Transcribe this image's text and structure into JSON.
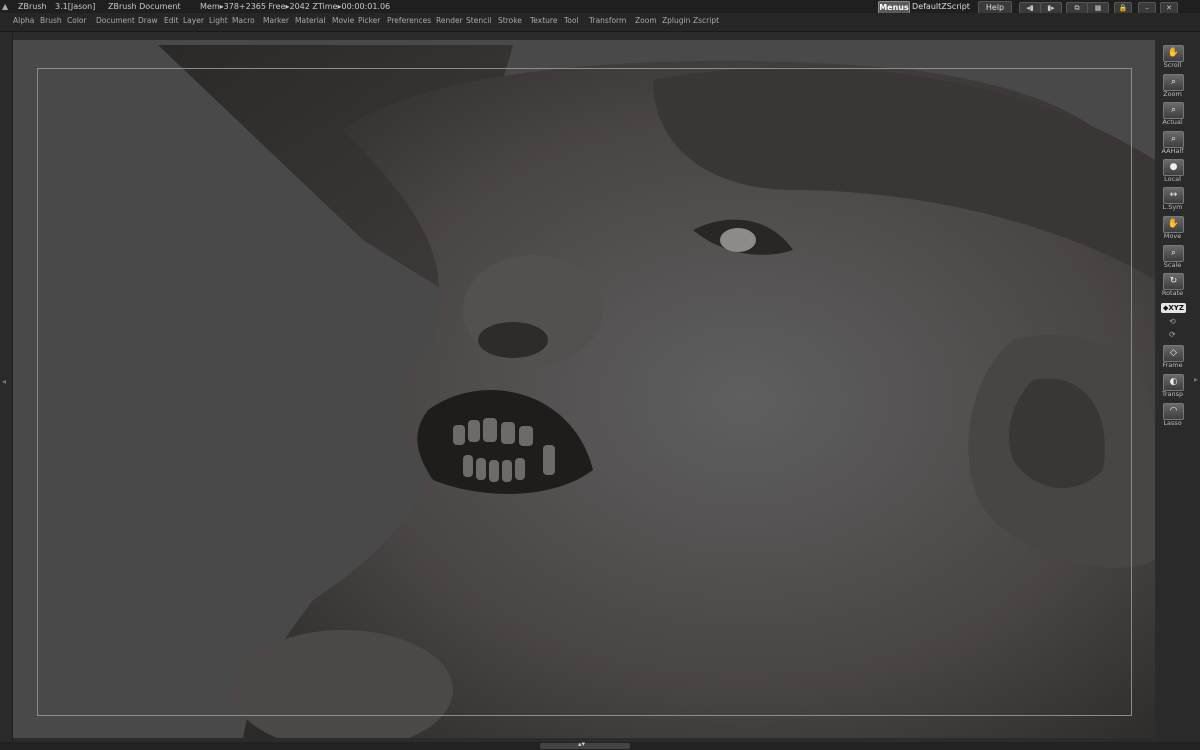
{
  "titlebar": {
    "app": "ZBrush",
    "version": "3.1[Jason]",
    "document": "ZBrush Document",
    "mem": "Mem▸378+2365 Free▸2042 ZTime▸00:00:01.06"
  },
  "topright": {
    "menus": "Menus",
    "script": "DefaultZScript",
    "help": "Help"
  },
  "menubar": [
    "Alpha",
    "Brush",
    "Color",
    "Document",
    "Draw",
    "Edit",
    "Layer",
    "Light",
    "Macro",
    "Marker",
    "Material",
    "Movie",
    "Picker",
    "Preferences",
    "Render",
    "Stencil",
    "Stroke",
    "Texture",
    "Tool",
    "Transform",
    "Zoom",
    "Zplugin",
    "Zscript"
  ],
  "right_tools": [
    {
      "label": "Scroll",
      "icon": "hand-icon"
    },
    {
      "label": "Zoom",
      "icon": "magnifier-icon"
    },
    {
      "label": "Actual",
      "icon": "magnifier-icon"
    },
    {
      "label": "AAHalf",
      "icon": "magnifier-icon"
    },
    {
      "label": "Local",
      "icon": "sphere-icon"
    },
    {
      "label": "L.Sym",
      "icon": "symmetry-icon"
    },
    {
      "label": "Move",
      "icon": "hand-icon"
    },
    {
      "label": "Scale",
      "icon": "magnifier-icon"
    },
    {
      "label": "Rotate",
      "icon": "rotate-icon"
    }
  ],
  "xyz_label": "◆XYZ",
  "lower_tools": [
    {
      "label": "Frame",
      "icon": "cube-icon"
    },
    {
      "label": "Transp",
      "icon": "transparency-icon"
    },
    {
      "label": "Lasso",
      "icon": "lasso-icon"
    }
  ]
}
